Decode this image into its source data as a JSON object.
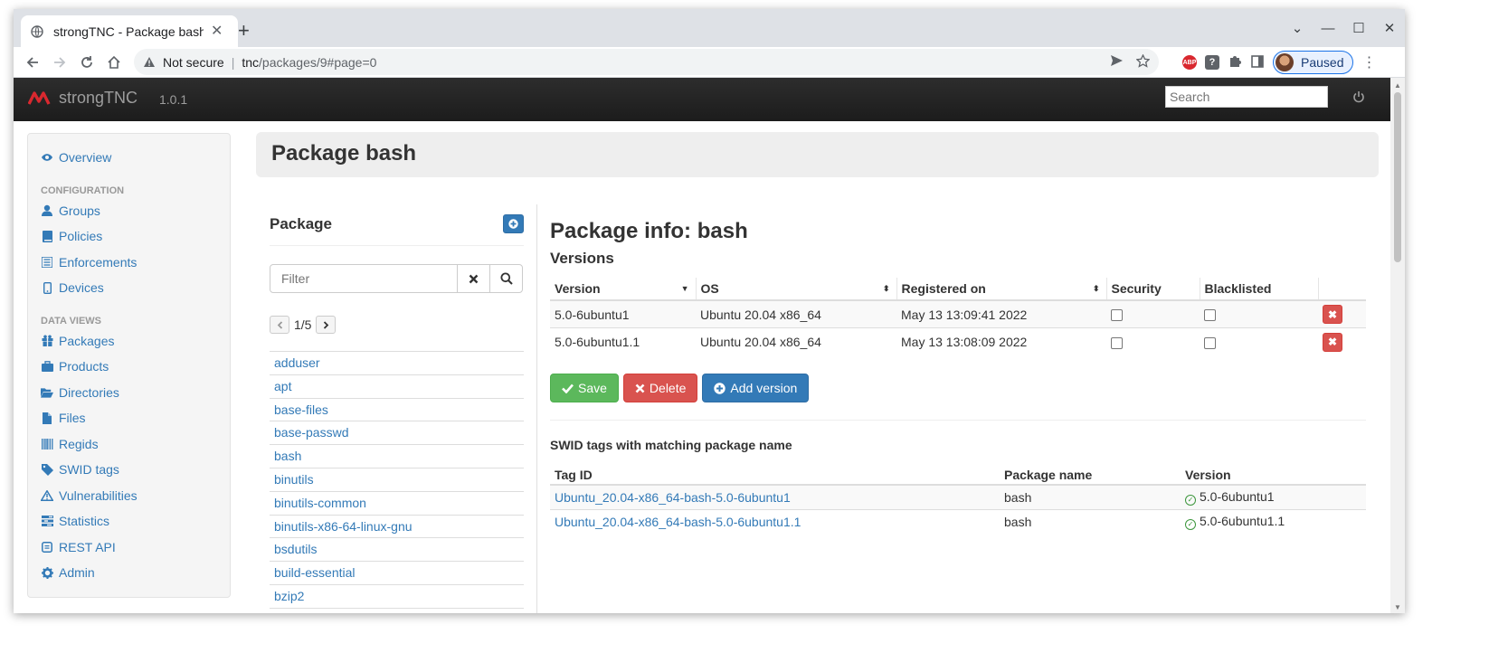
{
  "browser": {
    "tab_title": "strongTNC - Package bash",
    "security_label": "Not secure",
    "url_host": "tnc",
    "url_path": "/packages/9#page=0",
    "profile_label": "Paused"
  },
  "navbar": {
    "brand": "strongTNC",
    "version": "1.0.1",
    "search_placeholder": "Search"
  },
  "sidebar": {
    "overview": "Overview",
    "config_header": "CONFIGURATION",
    "config_items": [
      {
        "label": "Groups",
        "icon": "user-icon"
      },
      {
        "label": "Policies",
        "icon": "book-icon"
      },
      {
        "label": "Enforcements",
        "icon": "list-icon"
      },
      {
        "label": "Devices",
        "icon": "phone-icon"
      }
    ],
    "data_header": "DATA VIEWS",
    "data_items": [
      {
        "label": "Packages",
        "icon": "gift-icon"
      },
      {
        "label": "Products",
        "icon": "briefcase-icon"
      },
      {
        "label": "Directories",
        "icon": "folder-open-icon"
      },
      {
        "label": "Files",
        "icon": "file-icon"
      },
      {
        "label": "Regids",
        "icon": "barcode-icon"
      },
      {
        "label": "SWID tags",
        "icon": "tag-icon"
      },
      {
        "label": "Vulnerabilities",
        "icon": "warning-icon"
      },
      {
        "label": "Statistics",
        "icon": "tasks-icon"
      },
      {
        "label": "REST API",
        "icon": "unchecked-icon"
      },
      {
        "label": "Admin",
        "icon": "cog-icon"
      }
    ]
  },
  "page": {
    "title": "Package bash"
  },
  "packages": {
    "title": "Package",
    "filter_placeholder": "Filter",
    "pagination": "1/5",
    "items": [
      "adduser",
      "apt",
      "base-files",
      "base-passwd",
      "bash",
      "binutils",
      "binutils-common",
      "binutils-x86-64-linux-gnu",
      "bsdutils",
      "build-essential",
      "bzip2"
    ]
  },
  "info": {
    "title": "Package info: bash",
    "versions_title": "Versions",
    "columns": [
      "Version",
      "OS",
      "Registered on",
      "Security",
      "Blacklisted"
    ],
    "rows": [
      {
        "version": "5.0-6ubuntu1",
        "os": "Ubuntu 20.04 x86_64",
        "registered": "May 13 13:09:41 2022"
      },
      {
        "version": "5.0-6ubuntu1.1",
        "os": "Ubuntu 20.04 x86_64",
        "registered": "May 13 13:08:09 2022"
      }
    ],
    "save_label": "Save",
    "delete_label": "Delete",
    "add_version_label": "Add version",
    "swid_title": "SWID tags with matching package name",
    "swid_columns": [
      "Tag ID",
      "Package name",
      "Version"
    ],
    "swid_rows": [
      {
        "tag_id": "Ubuntu_20.04-x86_64-bash-5.0-6ubuntu1",
        "package": "bash",
        "version": "5.0-6ubuntu1"
      },
      {
        "tag_id": "Ubuntu_20.04-x86_64-bash-5.0-6ubuntu1.1",
        "package": "bash",
        "version": "5.0-6ubuntu1.1"
      }
    ]
  },
  "colors": {
    "link": "#337ab7",
    "navbar": "#222222",
    "success": "#5cb85c",
    "danger": "#d9534f",
    "primary": "#337ab7"
  }
}
